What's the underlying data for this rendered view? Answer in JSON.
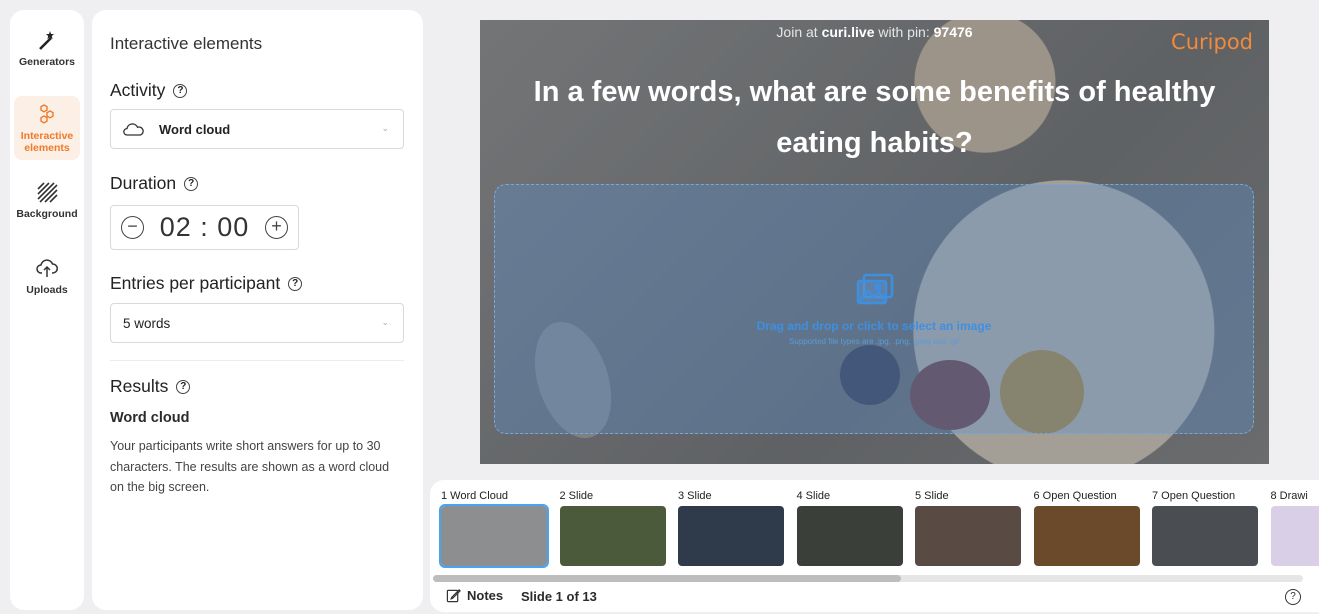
{
  "rail": {
    "items": [
      {
        "label": "Generators",
        "icon": "magic-wand-icon"
      },
      {
        "label": "Interactive elements",
        "icon": "hexagons-icon",
        "active": true
      },
      {
        "label": "Background",
        "icon": "hatch-pattern-icon"
      },
      {
        "label": "Uploads",
        "icon": "cloud-upload-icon"
      }
    ]
  },
  "panel": {
    "heading": "Interactive elements",
    "activity": {
      "title": "Activity",
      "value": "Word cloud",
      "icon": "cloud-icon"
    },
    "duration": {
      "title": "Duration",
      "value": "02 : 00"
    },
    "entries": {
      "title": "Entries per participant",
      "value": "5 words"
    },
    "results": {
      "title": "Results",
      "subtitle": "Word cloud",
      "description": "Your participants write short answers for up to 30 characters. The results are shown as a word cloud on the big screen."
    }
  },
  "slide": {
    "join_prefix": "Join at ",
    "join_site": "curi.live",
    "join_mid": " with pin: ",
    "join_pin": "97476",
    "brand": "Curipod",
    "question": "In a few words, what are some benefits of healthy eating habits?",
    "drop_text": "Drag and drop or click to select an image",
    "drop_hint": "Supported file types are .jpg, .png, .jpeg and .gif"
  },
  "thumbnails": [
    {
      "label": "1 Word Cloud",
      "selected": true,
      "color": "#8d8e8f"
    },
    {
      "label": "2 Slide",
      "color": "#4c5a3c"
    },
    {
      "label": "3 Slide",
      "color": "#2f3b4a"
    },
    {
      "label": "4 Slide",
      "color": "#3a3f3a"
    },
    {
      "label": "5 Slide",
      "color": "#5a4a44"
    },
    {
      "label": "6 Open Question",
      "color": "#6a4a2a"
    },
    {
      "label": "7 Open Question",
      "color": "#4a4d52"
    },
    {
      "label": "8 Drawi",
      "color": "#d9cfe6"
    }
  ],
  "footer": {
    "notes_label": "Notes",
    "slide_count": "Slide 1 of 13"
  }
}
